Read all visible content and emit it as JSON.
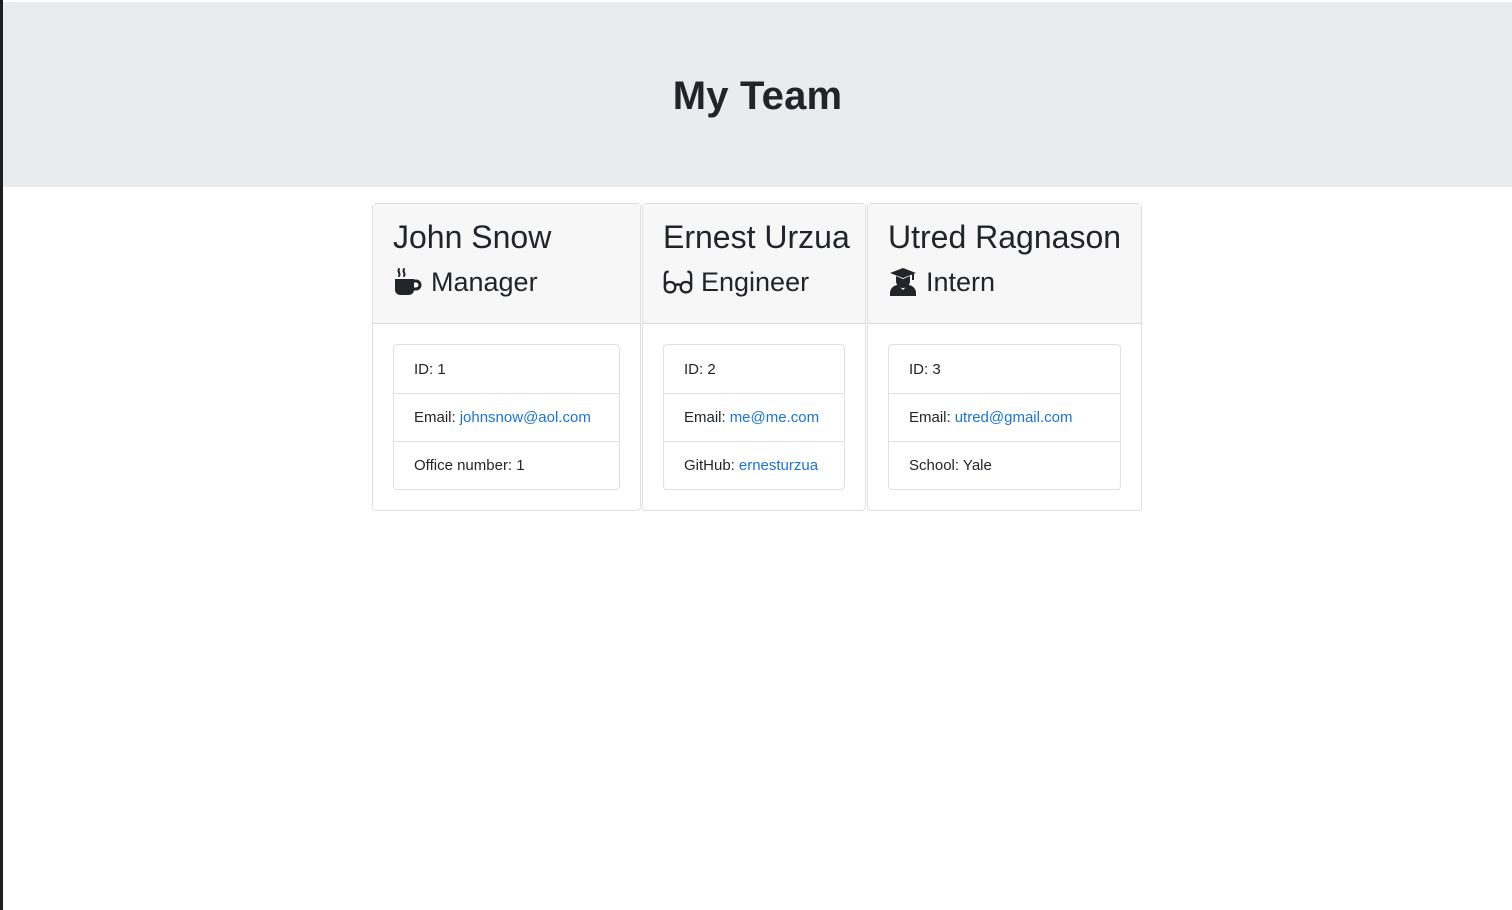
{
  "header": {
    "title": "My Team"
  },
  "team": [
    {
      "name": "John Snow",
      "role": "Manager",
      "role_icon": "mug-hot-icon",
      "id_text": "ID: 1",
      "email_label": "Email:",
      "email": "johnsnow@aol.com",
      "extra_label": "Office number: 1",
      "extra_link": ""
    },
    {
      "name": "Ernest Urzua",
      "role": "Engineer",
      "role_icon": "glasses-icon",
      "id_text": "ID: 2",
      "email_label": "Email:",
      "email": "me@me.com",
      "extra_label": "GitHub:",
      "extra_link": "ernesturzua"
    },
    {
      "name": "Utred Ragnason",
      "role": "Intern",
      "role_icon": "user-graduate-icon",
      "id_text": "ID: 3",
      "email_label": "Email:",
      "email": "utred@gmail.com",
      "extra_label": "School: Yale",
      "extra_link": ""
    }
  ],
  "colors": {
    "header_bg": "#e9ecef",
    "card_header_bg": "#f7f7f7",
    "link": "#1a73d9",
    "text": "#212529"
  }
}
